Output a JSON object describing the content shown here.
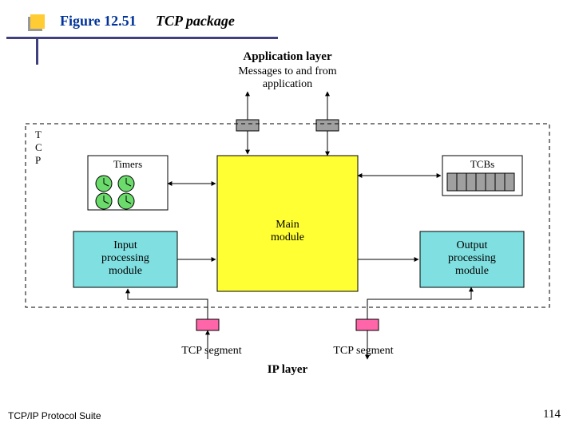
{
  "header": {
    "figno": "Figure 12.51",
    "title": "TCP package"
  },
  "labels": {
    "app_layer": "Application layer",
    "msgs1": "Messages to and from",
    "msgs2": "application",
    "tcp_box": "T\nC\nP",
    "timers": "Timers",
    "tcbs": "TCBs",
    "main": "Main\nmodule",
    "input": "Input\nprocessing\nmodule",
    "output": "Output\nprocessing\nmodule",
    "seg_left": "TCP segment",
    "seg_right": "TCP segment",
    "ip_layer": "IP layer"
  },
  "footer": {
    "left": "TCP/IP Protocol Suite",
    "right": "114"
  },
  "chart_data": {
    "type": "diagram",
    "title": "TCP package",
    "nodes": [
      {
        "id": "app",
        "label": "Application layer",
        "note": "Messages to and from application"
      },
      {
        "id": "tcp",
        "label": "TCP (dashed container)"
      },
      {
        "id": "timers",
        "label": "Timers"
      },
      {
        "id": "tcbs",
        "label": "TCBs"
      },
      {
        "id": "main",
        "label": "Main module"
      },
      {
        "id": "input",
        "label": "Input processing module"
      },
      {
        "id": "output",
        "label": "Output processing module"
      },
      {
        "id": "ip",
        "label": "IP layer"
      }
    ],
    "edges": [
      {
        "from": "app",
        "to": "main",
        "dir": "both"
      },
      {
        "from": "timers",
        "to": "main",
        "dir": "both"
      },
      {
        "from": "tcbs",
        "to": "main",
        "dir": "both"
      },
      {
        "from": "input",
        "to": "main",
        "dir": "to"
      },
      {
        "from": "main",
        "to": "output",
        "dir": "to"
      },
      {
        "from": "ip",
        "to": "input",
        "dir": "to",
        "label": "TCP segment"
      },
      {
        "from": "output",
        "to": "ip",
        "dir": "to",
        "label": "TCP segment"
      }
    ]
  }
}
